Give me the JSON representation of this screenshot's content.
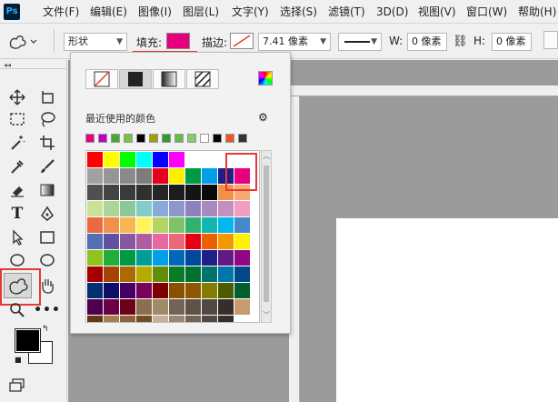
{
  "menu": {
    "logo": "Ps",
    "items": [
      "文件(F)",
      "编辑(E)",
      "图像(I)",
      "图层(L)",
      "文字(Y)",
      "选择(S)",
      "滤镜(T)",
      "3D(D)",
      "视图(V)",
      "窗口(W)",
      "帮助(H)"
    ]
  },
  "options": {
    "mode_value": "形状",
    "fill_label": "填充:",
    "fill_color": "#e6007e",
    "stroke_label": "描边:",
    "stroke_width": "7.41 像素",
    "w_label": "W:",
    "w_value": "0 像素",
    "h_label": "H:",
    "h_value": "0 像素"
  },
  "popup": {
    "recent_label": "最近使用的颜色",
    "recent_colors": [
      "#e6007e",
      "#c000c0",
      "#44aa33",
      "#7cc241",
      "#000000",
      "#a0a000",
      "#339933",
      "#66bb44",
      "#88cc66",
      "#ffffff",
      "#000000",
      "#ee5522",
      "#333333"
    ],
    "swatch_rows": [
      [
        "#ff0000",
        "#ffff00",
        "#00ff00",
        "#00ffff",
        "#0000ff",
        "#ff00ff",
        "#ffffff",
        "#ffffff",
        "#ffffff",
        "#ffffff"
      ],
      [
        "#a0a0a0",
        "#969696",
        "#8a8a8a",
        "#7c7c7c",
        "#e6001e",
        "#fff000",
        "#009944",
        "#00a0e9",
        "#1d2088",
        "#e6007e"
      ],
      [
        "#505050",
        "#444444",
        "#3a3a3a",
        "#303030",
        "#262626",
        "#1c1c1c",
        "#141414",
        "#0a0a0a",
        "#f19149",
        "#f6a973"
      ],
      [
        "#cce198",
        "#acd598",
        "#89c997",
        "#84ccc9",
        "#88abda",
        "#8c97cb",
        "#8f82bc",
        "#aa89bd",
        "#c490bf",
        "#f19ec2"
      ],
      [
        "#ec6941",
        "#f19149",
        "#f8b551",
        "#fff45c",
        "#b3d465",
        "#80c269",
        "#32b16c",
        "#13b5b1",
        "#00b7ee",
        "#448aca"
      ],
      [
        "#556fb5",
        "#5f52a0",
        "#8957a1",
        "#ae5da1",
        "#ea68a2",
        "#eb6877",
        "#e60012",
        "#eb6100",
        "#f39800",
        "#fff100"
      ],
      [
        "#8fc31f",
        "#22ac38",
        "#009944",
        "#009e96",
        "#00a0e9",
        "#0068b7",
        "#00479d",
        "#1d2088",
        "#601986",
        "#920783"
      ],
      [
        "#a40000",
        "#a84200",
        "#ac6a00",
        "#b7aa00",
        "#638c0b",
        "#097c25",
        "#007130",
        "#00736d",
        "#0075a9",
        "#004986"
      ],
      [
        "#00306f",
        "#0e0d6a",
        "#440062",
        "#7a005d",
        "#7d0000",
        "#8a4f00",
        "#8f5700",
        "#837e00",
        "#4c5a00",
        "#006030"
      ],
      [
        "#4d004f",
        "#6a0046",
        "#6e0019",
        "#8b6f4e",
        "#a08a68",
        "#736357",
        "#5f5147",
        "#534741",
        "#362e2b",
        "#c69c6d"
      ],
      [
        "#603813",
        "#a67c52",
        "#8c6239",
        "#754c24",
        "#c7b299",
        "#998675",
        "#736357",
        "#534741",
        "#362e2b",
        "#ffffff"
      ]
    ]
  },
  "colors": {
    "accent_red": "#e53935",
    "fg": "#000000",
    "bg": "#ffffff"
  }
}
